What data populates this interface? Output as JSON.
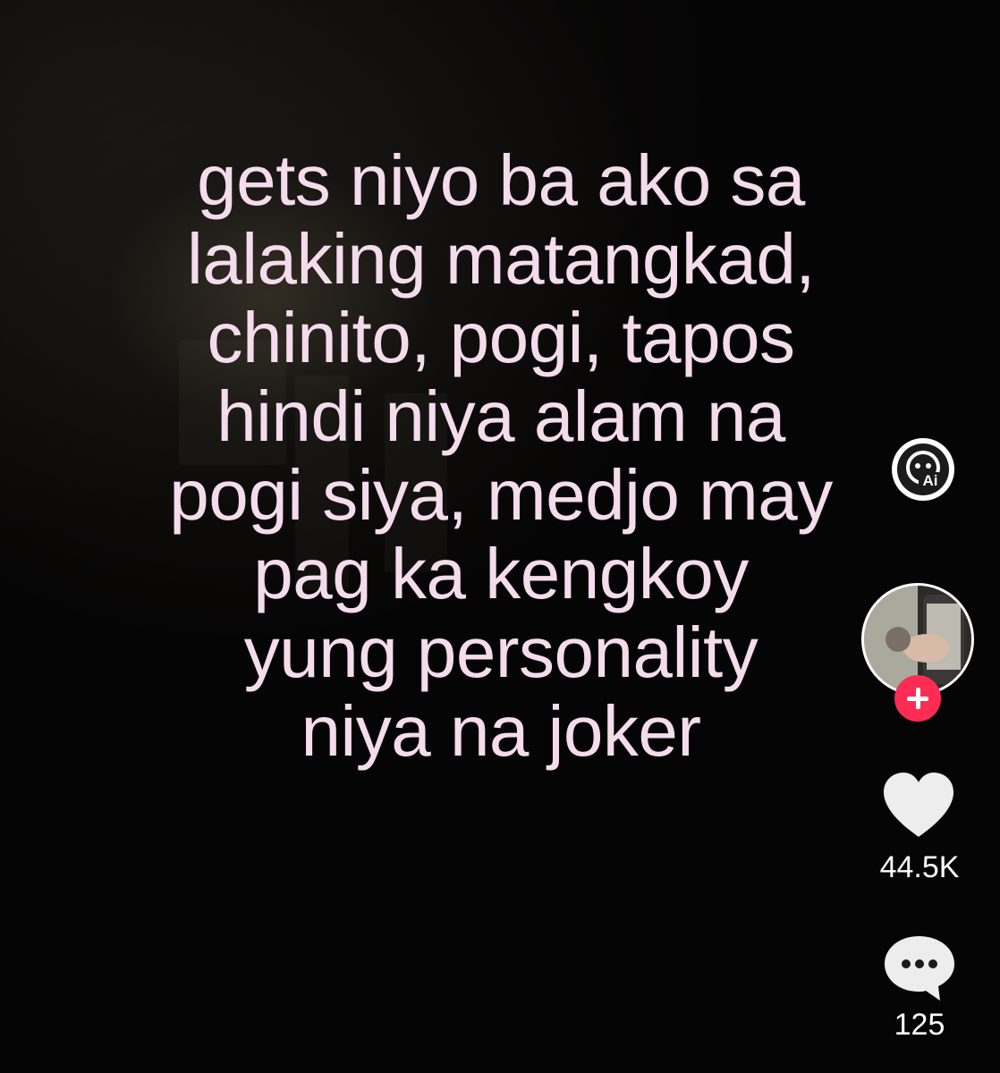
{
  "video": {
    "caption_lines": [
      "gets niyo ba ako sa",
      "lalaking matangkad,",
      "chinito, pogi, tapos",
      "hindi niya alam na",
      "pogi siya, medjo may",
      "pag ka kengkoy",
      "yung personality",
      "niya na joker"
    ],
    "caption_color": "#f4dcec"
  },
  "sidebar": {
    "ai_badge_icon": "ai-effect-icon",
    "avatar_icon": "creator-avatar",
    "follow_icon": "plus-icon",
    "follow_color": "#fe2c55",
    "like_icon": "heart-icon",
    "like_count": "44.5K",
    "comment_icon": "comment-bubble-icon",
    "comment_count": "125"
  }
}
